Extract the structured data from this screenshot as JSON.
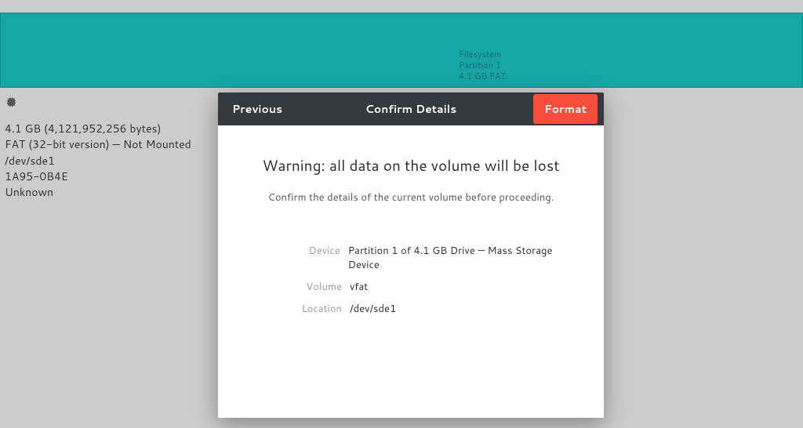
{
  "partition_banner": {
    "title": "Filesystem",
    "subtitle": "Partition 1",
    "size_line": "4.1 GB FAT"
  },
  "sidebar": {
    "size_line": "4.1 GB (4,121,952,256 bytes)",
    "fs_line": "FAT (32-bit version) — Not Mounted",
    "device_line": "/dev/sde1",
    "uuid_line": "1A95-0B4E",
    "owner_line": "Unknown"
  },
  "dialog": {
    "previous_label": "Previous",
    "title": "Confirm Details",
    "format_label": "Format",
    "warning_heading": "Warning: all data on the volume will be lost",
    "warning_sub": "Confirm the details of the current volume before proceeding.",
    "rows": {
      "device_label": "Device",
      "device_value": "Partition 1 of 4.1 GB Drive — Mass Storage Device",
      "volume_label": "Volume",
      "volume_value": "vfat",
      "location_label": "Location",
      "location_value": "/dev/sde1"
    }
  }
}
